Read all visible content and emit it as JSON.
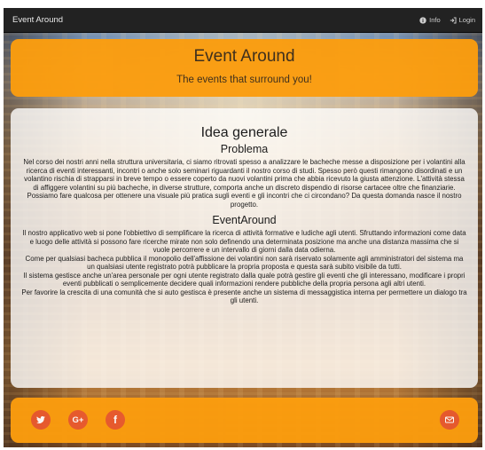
{
  "navbar": {
    "brand": "Event Around",
    "info_label": "Info",
    "login_label": "Login"
  },
  "header": {
    "title": "Event Around",
    "subtitle": "The events that surround you!"
  },
  "content": {
    "heading": "Idea generale",
    "section1": {
      "title": "Problema",
      "paragraphs": [
        "Nel corso dei nostri anni nella struttura universitaria, ci siamo ritrovati spesso a analizzare le bacheche messe a disposizione per i volantini alla ricerca di eventi interessanti, incontri o anche solo seminari riguardanti il nostro corso di studi. Spesso però questi rimangono disordinati e un volantino rischia di strapparsi in breve tempo o essere coperto da nuovi volantini prima che abbia ricevuto la giusta attenzione. L'attività stessa di affiggere volantini su più bacheche, in diverse strutture, comporta anche un discreto dispendio di risorse cartacee oltre che finanziarie.",
        "Possiamo fare qualcosa per ottenere una visuale più pratica sugli eventi e gli incontri che ci circondano? Da questa domanda nasce il nostro progetto."
      ]
    },
    "section2": {
      "title": "EventAround",
      "paragraphs": [
        "Il nostro applicativo web si pone l'obbiettivo di semplificare la ricerca di attività formative e ludiche agli utenti. Sfruttando informazioni come data e luogo delle attività si possono fare ricerche mirate non solo definendo una determinata posizione ma anche una distanza massima che si vuole percorrere e un intervallo di giorni dalla data odierna.",
        "Come per qualsiasi bacheca pubblica il monopolio dell'affissione dei volantini non sarà riservato solamente agli amministratori del sistema ma un qualsiasi utente registrato potrà pubblicare la propria proposta e questa sarà subito visibile da tutti.",
        "Il sistema gestisce anche un'area personale per ogni utente registrato dalla quale potrà gestire gli eventi che gli interessano, modificare i propri eventi pubblicati o semplicemente decidere quali informazioni rendere pubbliche della propria persona agli altri utenti.",
        "Per favorire la crescita di una comunità che si auto gestisca è presente anche un sistema di messaggistica interna per permettere un dialogo tra gli utenti."
      ]
    }
  },
  "footer": {
    "google_plus_label": "G+",
    "facebook_label": "f"
  },
  "colors": {
    "accent_orange": "#fc9d0e",
    "social_red": "#ea5a2e",
    "navbar": "#222222"
  },
  "icons": [
    "info-icon",
    "login-icon",
    "twitter-icon",
    "google-plus-icon",
    "facebook-icon",
    "envelope-icon"
  ]
}
